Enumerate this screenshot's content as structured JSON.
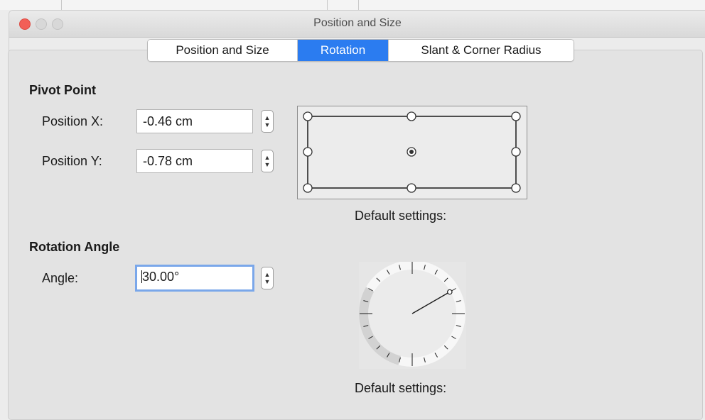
{
  "window": {
    "title": "Position and Size"
  },
  "tabs": [
    {
      "label": "Position and Size",
      "active": false
    },
    {
      "label": "Rotation",
      "active": true
    },
    {
      "label": "Slant & Corner Radius",
      "active": false
    }
  ],
  "pivot_point": {
    "heading": "Pivot Point",
    "position_x_label": "Position X:",
    "position_x_value": "-0.46 cm",
    "position_y_label": "Position Y:",
    "position_y_value": "-0.78 cm",
    "default_settings_label": "Default settings:",
    "selected_point": "center"
  },
  "rotation_angle": {
    "heading": "Rotation Angle",
    "angle_label": "Angle:",
    "angle_value": "30.00°",
    "angle_degrees": 30,
    "default_settings_label": "Default settings:"
  },
  "colors": {
    "accent": "#2b7cf0",
    "close_button": "#f25f57",
    "focus_ring": "#7aa7ea"
  }
}
